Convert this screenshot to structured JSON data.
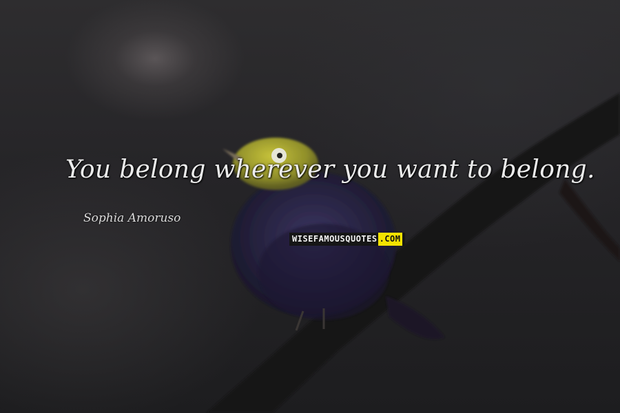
{
  "quote": {
    "text": "You belong wherever you want to belong.",
    "author": "Sophia Amoruso"
  },
  "watermark": {
    "main": "WISEFAMOUSQUOTES",
    "highlight": ".COM"
  },
  "colors": {
    "background": "#262528",
    "bird_head": "#a8a830",
    "bird_body": "#24203c",
    "branch": "#151314",
    "watermark_highlight": "#f4e300"
  }
}
